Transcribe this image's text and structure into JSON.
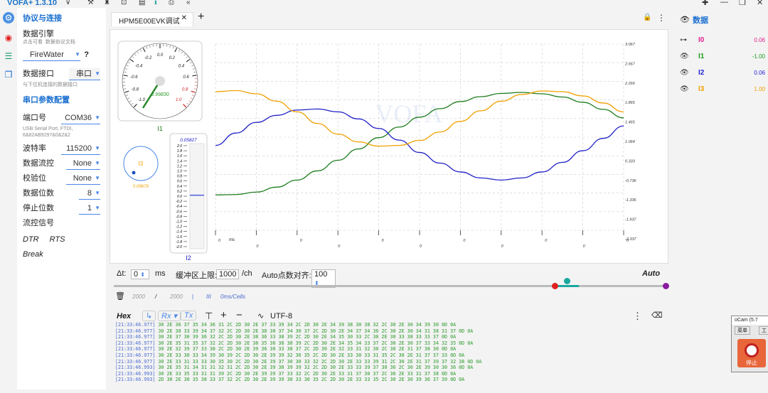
{
  "app": {
    "title": "VOFA+ 1.3.10"
  },
  "sidebar": {
    "section1_title": "协议与连接",
    "engine_label": "数据引擎",
    "engine_hint1": "点击可看",
    "engine_hint2": "数据协议文档",
    "engine_value": "FireWater",
    "help": "?",
    "interface_label": "数据接口",
    "interface_value": "串口",
    "interface_hint": "与下位机连接的数据接口",
    "section2_title": "串口参数配置",
    "port_label": "端口号",
    "port_value": "COM36",
    "port_desc1": "USB Serial Port, FTDI,",
    "port_desc2": "6&82AB9297&0&2&2",
    "baud_label": "波特率",
    "baud_value": "115200",
    "flowctl_label": "数据流控",
    "flowctl_value": "None",
    "parity_label": "校验位",
    "parity_value": "None",
    "databits_label": "数据位数",
    "databits_value": "8",
    "stopbits_label": "停止位数",
    "stopbits_value": "1",
    "flow_signal_label": "流控信号",
    "flow_btns": [
      "DTR",
      "RTS",
      "Break"
    ]
  },
  "tab": {
    "label": "HPM5E00EVK调试",
    "add": "+"
  },
  "gauge": {
    "name": "I1",
    "value_text": "0.99830",
    "ticks": [
      "-1.0",
      "-0.8",
      "-0.6",
      "-0.4",
      "-0.2",
      "0.0",
      "0.2",
      "0.4",
      "0.6",
      "0.8",
      "1.0"
    ]
  },
  "dial": {
    "name": "I3",
    "value_text": "0.09679"
  },
  "bar_meter": {
    "name": "I2",
    "value_text": "0.05827",
    "ticks": [
      "2.0",
      "1.8",
      "1.6",
      "1.4",
      "1.2",
      "1.0",
      "0.8",
      "0.6",
      "0.4",
      "0.2",
      "0.0",
      "-0.2",
      "-0.4",
      "-0.6",
      "-0.8",
      "-1.0",
      "-1.2",
      "-1.4",
      "-1.6",
      "-1.8",
      "-2.0"
    ],
    "value": 0.058
  },
  "chart_data": {
    "type": "line",
    "title": "",
    "xlabel": "",
    "ylabel": "",
    "ylim": [
      -2.2,
      3.067
    ],
    "y_ticks": [
      "3.067",
      "2.667",
      "2.266",
      "1.865",
      "1.465",
      "1.064",
      "0.333",
      "-0.736",
      "-1.336",
      "-1.937",
      "-2.337"
    ],
    "x_ticks": [
      "0",
      "0",
      "0",
      "0",
      "0",
      "0",
      "0",
      "0",
      "0",
      "0",
      "0"
    ],
    "x_unit": "ms",
    "x": [
      0,
      1,
      2,
      3,
      4,
      5,
      6,
      7,
      8,
      9,
      10,
      11,
      12,
      13,
      14,
      15,
      16,
      17,
      18,
      19,
      20
    ],
    "series": [
      {
        "name": "I1",
        "color": "#1e7d1e",
        "values": [
          -1.2,
          -1.19,
          -1.12,
          -0.98,
          -0.78,
          -0.52,
          -0.22,
          0.1,
          0.42,
          0.72,
          1.0,
          1.24,
          1.44,
          1.58,
          1.67,
          1.7,
          1.66,
          1.57,
          1.42,
          1.22,
          0.98
        ]
      },
      {
        "name": "I2",
        "color": "#2020c8",
        "values": [
          0.2,
          0.55,
          0.85,
          1.05,
          1.2,
          1.23,
          1.15,
          0.95,
          0.68,
          0.35,
          0.0,
          -0.3,
          -0.55,
          -0.72,
          -0.78,
          -0.72,
          -0.55,
          -0.28,
          0.05,
          0.4,
          0.75
        ]
      },
      {
        "name": "I3",
        "color": "#f0a000",
        "values": [
          1.72,
          1.75,
          1.66,
          1.45,
          1.15,
          0.82,
          0.52,
          0.3,
          0.18,
          0.2,
          0.34,
          0.58,
          0.88,
          1.18,
          1.45,
          1.64,
          1.74,
          1.72,
          1.6,
          1.4,
          1.15
        ]
      }
    ],
    "grid": true
  },
  "controls": {
    "dt_label": "Δt:",
    "dt_value": "0",
    "dt_unit": "ms",
    "buffer_label": "缓冲区上限:",
    "buffer_value": "1000",
    "buffer_unit": "/ch",
    "autoalign_label": "Auto点数对齐:",
    "autoalign_value": "100",
    "auto": "Auto"
  },
  "console": {
    "a": "2000",
    "b": "/",
    "c": "2000",
    "d": "|",
    "e": "III",
    "f": "0ms/Cells"
  },
  "toolbar": {
    "hex": "Hex",
    "rx": "Rx",
    "tx": "Tx",
    "encoding": "UTF-8"
  },
  "log_lines": [
    {
      "ts": "[21:33:46.977]",
      "data": " 30 2E 36 37 35 34 36 31 2C 2D 30 2E 37 33 39 34 2C 2D 30 2E 34 39 38 30 38 32 2C 30 2E 30 34 39 30 0D 0A"
    },
    {
      "ts": "[21:33:46.977]",
      "data": " 30 2E 38 33 39 34 37 32 2C 2D 30 2E 38 30 37 34 30 37 2C 2D 30 2E 34 37 34 36 2C 30 2E 30 34 31 38 31 37 0D 0A"
    },
    {
      "ts": "[21:33:46.977]",
      "data": " 30 2E 37 30 39 36 32 2C 2D 30 2E 38 36 33 38 39 2C 2D 30 2E 34 35 30 33 2C 30 2E 30 33 38 33 33 37 0D 0A"
    },
    {
      "ts": "[21:33:46.977]",
      "data": " 30 2E 35 31 35 37 32 2C 2D 30 2E 38 35 36 38 38 39 2C 2D 30 2E 34 35 34 33 37 2C 30 2E 30 37 33 34 32 35 0D 0A"
    },
    {
      "ts": "[21:33:46.977]",
      "data": " 30 2E 32 39 37 33 38 2C 2D 30 2E 39 36 30 33 38 37 2C 2D 30 2E 32 33 31 32 30 2C 30 2E 31 37 38 30 0D 0A"
    },
    {
      "ts": "[21:33:46.977]",
      "data": " 30 2E 33 30 33 34 39 30 39 2C 2D 30 2E 39 39 32 36 35 2C 2D 30 2E 33 30 33 31 35 2C 30 2E 31 37 37 33 0D 0A"
    },
    {
      "ts": "[21:33:46.977]",
      "data": " 30 2E 33 31 33 33 30 35 30 2C 2D 30 2E 39 37 30 30 33 32 2C 2D 30 2E 33 33 39 31 2C 30 2E 31 37 39 37 32 38 0D 0A"
    },
    {
      "ts": "[21:33:46.993]",
      "data": " 30 2E 35 31 34 31 31 32 31 2C 2D 30 2E 39 38 39 39 32 2C 2D 30 2E 33 33 39 37 30 36 2C 30 2E 39 30 30 36 0D 0A"
    },
    {
      "ts": "[21:33:46.993]",
      "data": " 30 2E 33 35 33 31 31 39 2C 2D 30 2E 39 39 37 33 32 2C 2D 30 2E 33 31 37 30 37 2C 30 2E 33 31 37 38 0D 0A"
    },
    {
      "ts": "[21:33:46.993]",
      "data": " 2D 30 2E 30 35 38 33 37 32 2C 2D 30 2E 39 39 38 33 30 35 2C 2D 30 2E 33 33 35 2C 30 2E 30 39 36 37 39 0D 0A"
    }
  ],
  "right": {
    "title": "数据",
    "channels": [
      {
        "icon": "eye-off",
        "name": "I0",
        "value": "0.06",
        "color": "#e0208c"
      },
      {
        "icon": "eye",
        "name": "I1",
        "value": "-1.00",
        "color": "#1e9d1e"
      },
      {
        "icon": "eye",
        "name": "I2",
        "value": "0.06",
        "color": "#2020d8"
      },
      {
        "icon": "eye",
        "name": "I3",
        "value": "1.00",
        "color": "#f0a000"
      }
    ]
  },
  "popup": {
    "title": "oCam (5.7",
    "menu1": "菜单",
    "menu2": "工",
    "stop": "停止"
  }
}
